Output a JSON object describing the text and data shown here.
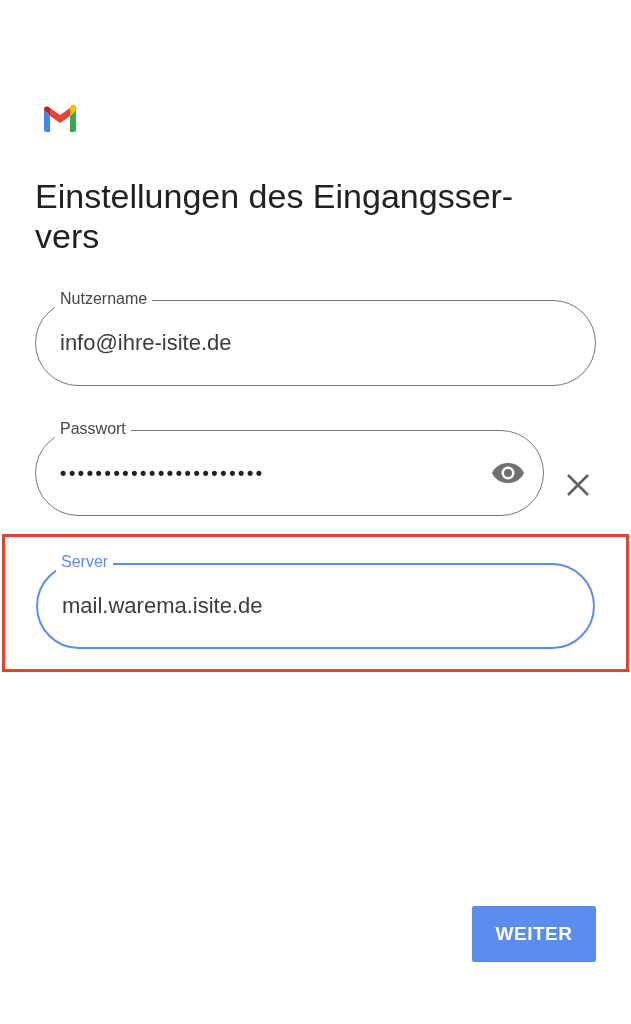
{
  "title_lines": [
    "Einstellungen des Eingangsser-",
    "vers"
  ],
  "fields": [
    {
      "kind": "text",
      "label": "Nutzername",
      "value": "info@ihre-isite.de",
      "focused": false,
      "highlighted": false
    },
    {
      "kind": "password",
      "label": "Passwort",
      "value": "•••••••••••••••••••••••",
      "focused": false,
      "highlighted": false
    },
    {
      "kind": "text",
      "label": "Server",
      "value": "mail.warema.isite.de",
      "focused": true,
      "highlighted": true
    }
  ],
  "next_button": "WEITER"
}
